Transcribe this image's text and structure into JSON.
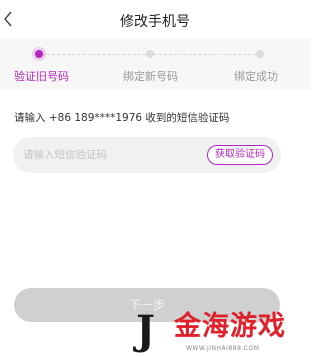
{
  "header": {
    "title": "修改手机号",
    "back_icon": "chevron-left-icon"
  },
  "steps": [
    {
      "label": "验证旧号码",
      "state": "active"
    },
    {
      "label": "绑定新号码",
      "state": "pending"
    },
    {
      "label": "绑定成功",
      "state": "pending"
    }
  ],
  "hint": "请输入 +86 189****1976 收到的短信验证码",
  "code": {
    "placeholder": "请输入短信验证码",
    "value": "",
    "send_label": "获取验证码"
  },
  "next_label": "下一步",
  "watermark": {
    "logo": "J",
    "text": "金海游戏",
    "url": "WWW.JINHAI888.COM"
  },
  "colors": {
    "accent": "#b227bd",
    "disabled_button": "#d0d0d0",
    "watermark_red": "#e0202a"
  }
}
